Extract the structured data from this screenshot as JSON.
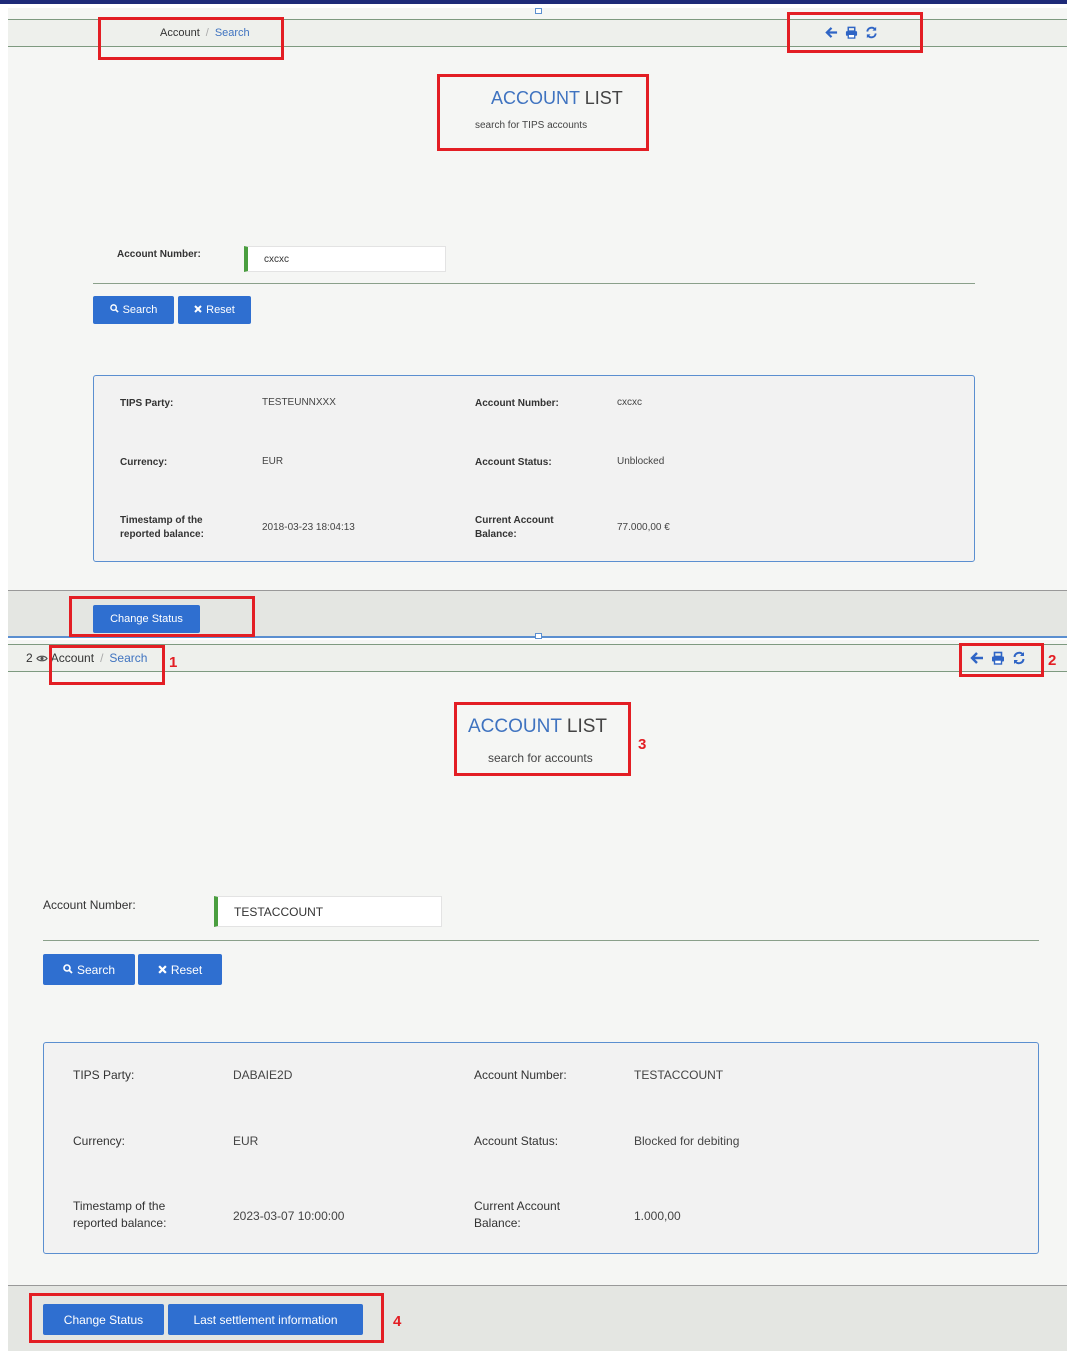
{
  "top": {
    "breadcrumb": {
      "root": "Account",
      "sep": "/",
      "current": "Search"
    },
    "title": {
      "part1": "ACCOUNT",
      "part2": "LIST"
    },
    "subtitle": "search for TIPS accounts",
    "search": {
      "label": "Account Number:",
      "value": "cxcxc",
      "search_btn": "Search",
      "reset_btn": "Reset"
    },
    "result": {
      "tips_party_label": "TIPS Party:",
      "tips_party": "TESTEUNNXXX",
      "acct_num_label": "Account Number:",
      "acct_num": "cxcxc",
      "currency_label": "Currency:",
      "currency": "EUR",
      "status_label": "Account Status:",
      "status": "Unblocked",
      "ts_label_1": "Timestamp of the",
      "ts_label_2": "reported balance:",
      "ts": "2018-03-23 18:04:13",
      "bal_label_1": "Current Account",
      "bal_label_2": "Balance:",
      "balance": "77.000,00 €"
    },
    "footer": {
      "change_status": "Change Status"
    }
  },
  "bottom": {
    "tab_count": "2",
    "breadcrumb": {
      "root": "Account",
      "sep": "/",
      "current": "Search"
    },
    "title": {
      "part1": "ACCOUNT",
      "part2": "LIST"
    },
    "subtitle": "search for accounts",
    "search": {
      "label": "Account Number:",
      "value": "TESTACCOUNT",
      "search_btn": "Search",
      "reset_btn": "Reset"
    },
    "result": {
      "tips_party_label": "TIPS Party:",
      "tips_party": "DABAIE2D",
      "acct_num_label": "Account Number:",
      "acct_num": "TESTACCOUNT",
      "currency_label": "Currency:",
      "currency": "EUR",
      "status_label": "Account Status:",
      "status": "Blocked for debiting",
      "ts_label_1": "Timestamp of the",
      "ts_label_2": "reported balance:",
      "ts": "2023-03-07 10:00:00",
      "bal_label_1": "Current Account",
      "bal_label_2": "Balance:",
      "balance": "1.000,00"
    },
    "footer": {
      "change_status": "Change Status",
      "last_settlement": "Last settlement information"
    }
  },
  "annotations": [
    "1",
    "2",
    "3",
    "4"
  ],
  "colors": {
    "accent": "#2f6fd0",
    "highlight": "#e31e24",
    "input_ok": "#4a9e3f"
  },
  "icons": [
    "arrow-left-icon",
    "print-icon",
    "refresh-icon",
    "eye-icon",
    "search-icon",
    "close-icon"
  ]
}
